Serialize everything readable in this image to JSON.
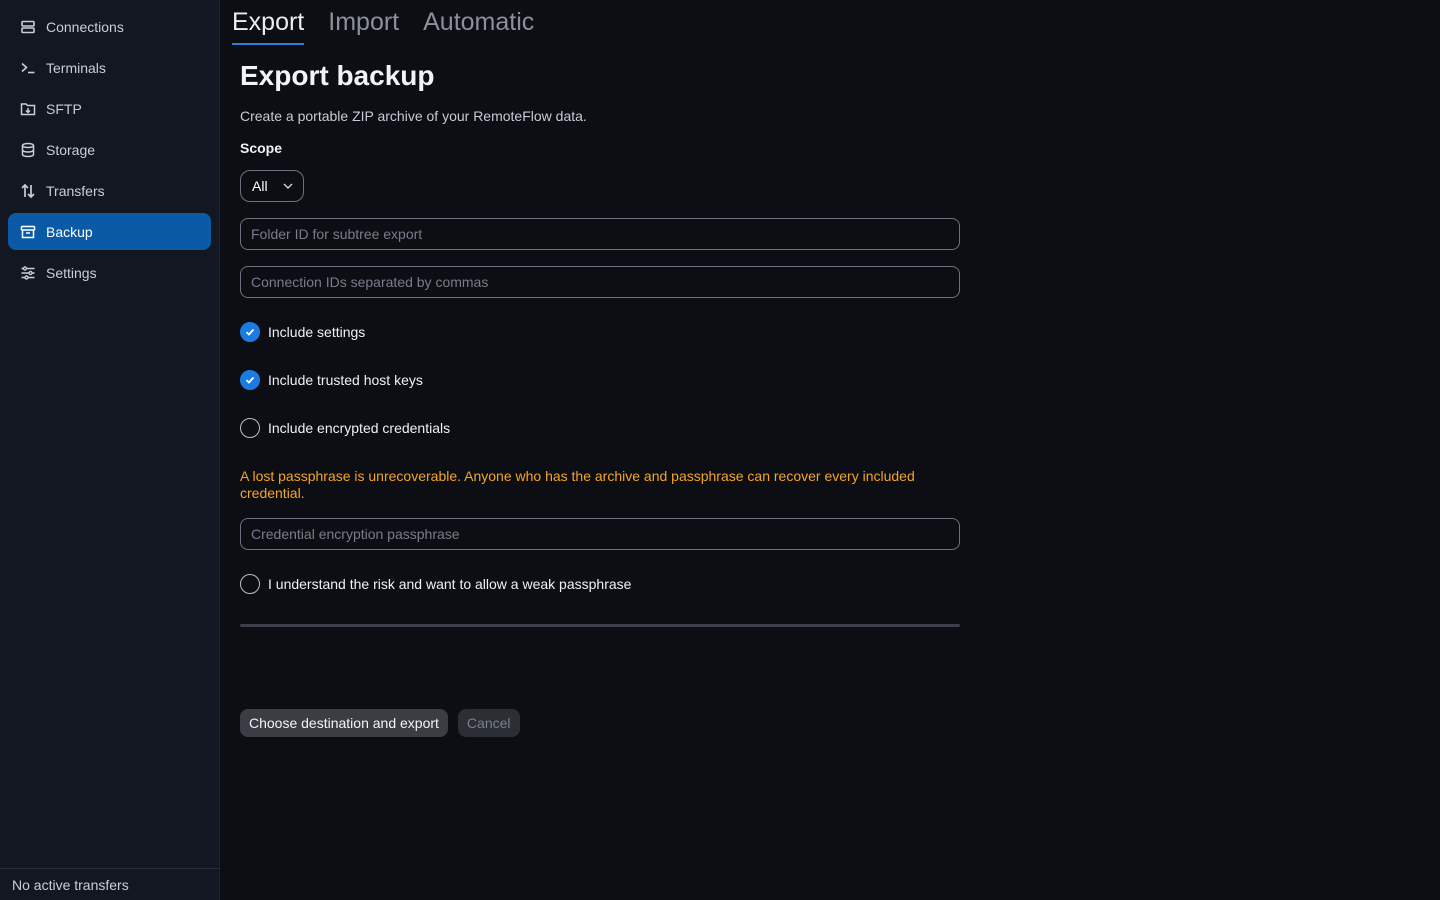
{
  "sidebar": {
    "items": [
      {
        "label": "Connections",
        "icon": "server-icon",
        "active": false
      },
      {
        "label": "Terminals",
        "icon": "terminal-icon",
        "active": false
      },
      {
        "label": "SFTP",
        "icon": "folder-transfer-icon",
        "active": false
      },
      {
        "label": "Storage",
        "icon": "database-icon",
        "active": false
      },
      {
        "label": "Transfers",
        "icon": "transfer-arrows-icon",
        "active": false
      },
      {
        "label": "Backup",
        "icon": "archive-icon",
        "active": true
      },
      {
        "label": "Settings",
        "icon": "sliders-icon",
        "active": false
      }
    ],
    "footer": "No active transfers"
  },
  "tabs": [
    {
      "label": "Export",
      "active": true
    },
    {
      "label": "Import",
      "active": false
    },
    {
      "label": "Automatic",
      "active": false
    }
  ],
  "form": {
    "title": "Export backup",
    "description": "Create a portable ZIP archive of your RemoteFlow data.",
    "scope_label": "Scope",
    "scope_value": "All",
    "folder_placeholder": "Folder ID for subtree export",
    "connections_placeholder": "Connection IDs separated by commas",
    "include_settings": {
      "label": "Include settings",
      "checked": true
    },
    "include_host_keys": {
      "label": "Include trusted host keys",
      "checked": true
    },
    "include_credentials": {
      "label": "Include encrypted credentials",
      "checked": false
    },
    "warning": "A lost passphrase is unrecoverable. Anyone who has the archive and passphrase can recover every included credential.",
    "passphrase_placeholder": "Credential encryption passphrase",
    "weak_passphrase": {
      "label": "I understand the risk and want to allow a weak passphrase",
      "checked": false
    },
    "progress": 0,
    "export_button": "Choose destination and export",
    "cancel_button": "Cancel"
  },
  "colors": {
    "accent": "#1c7be0",
    "active_nav": "#0b5aa6",
    "warning": "#f5a524",
    "background": "#0c0e14",
    "sidebar": "#121722"
  }
}
